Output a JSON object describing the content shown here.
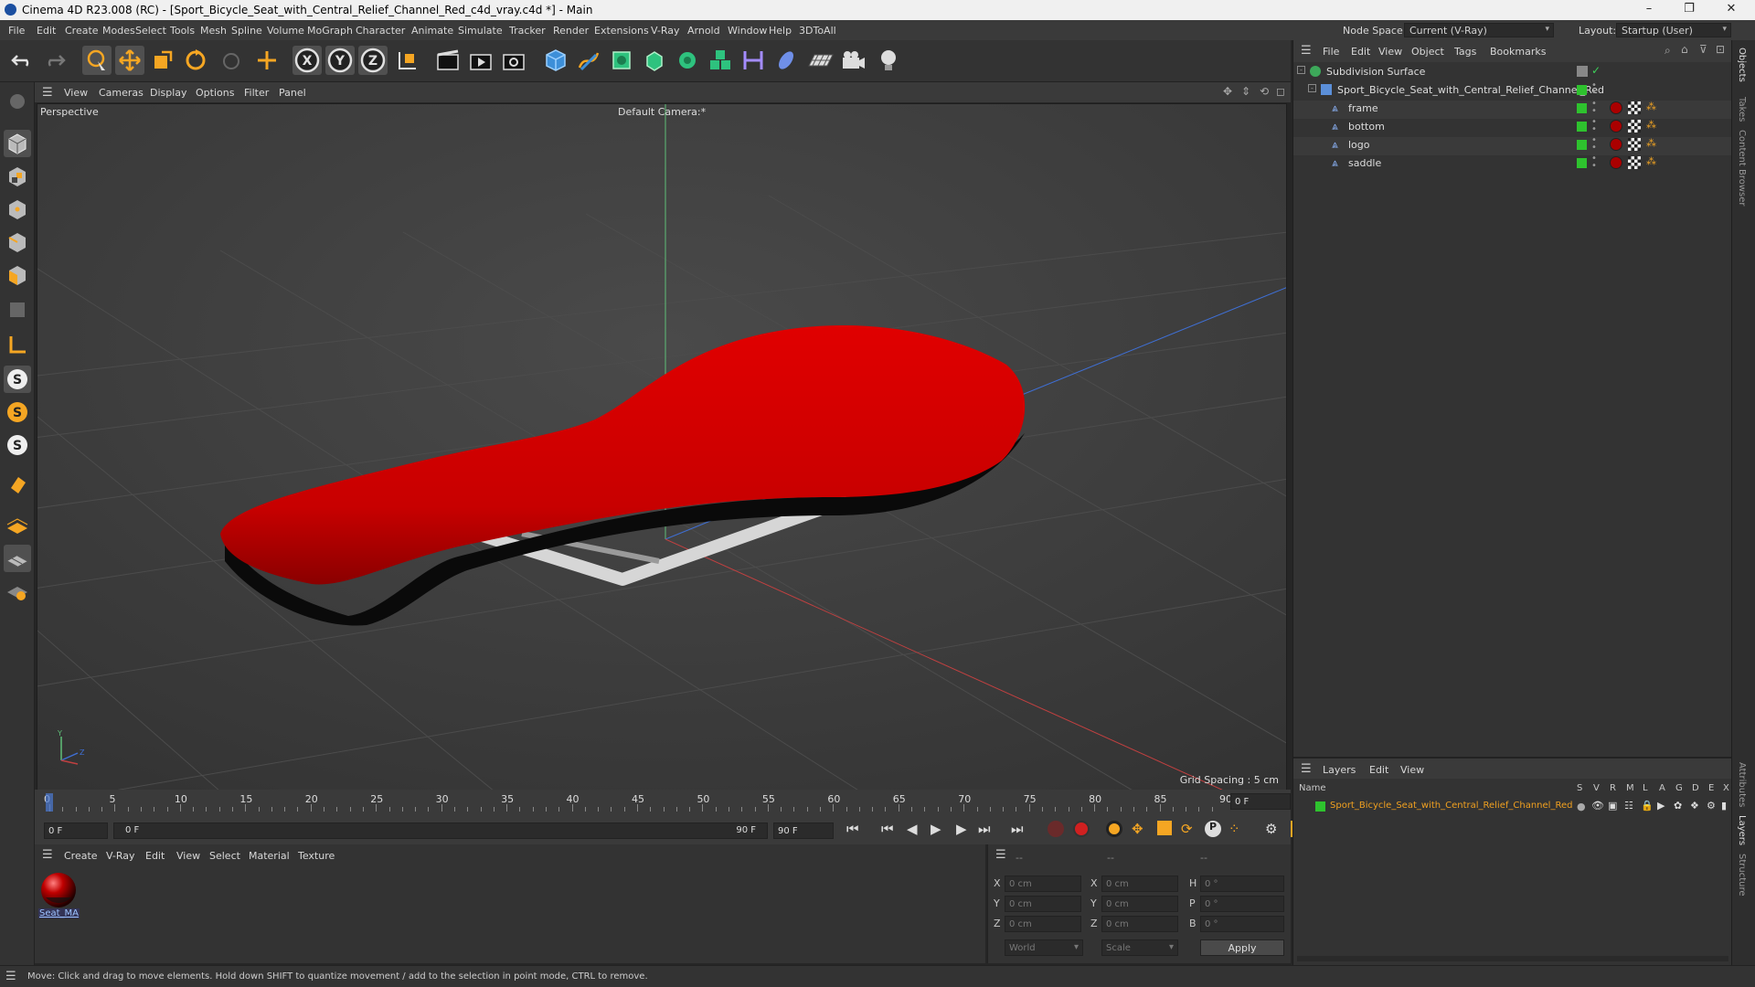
{
  "window": {
    "title": "Cinema 4D R23.008 (RC) - [Sport_Bicycle_Seat_with_Central_Relief_Channel_Red_c4d_vray.c4d *] - Main",
    "controls": [
      "–",
      "❐",
      "✕"
    ]
  },
  "menubar": {
    "items": [
      "File",
      "Edit",
      "Create",
      "Modes",
      "Select",
      "Tools",
      "Mesh",
      "Spline",
      "Volume",
      "MoGraph",
      "Character",
      "Animate",
      "Simulate",
      "Tracker",
      "Render",
      "Extensions",
      "V-Ray",
      "Arnold",
      "Window",
      "Help",
      "3DToAll"
    ],
    "node_space_label": "Node Space:",
    "node_space_value": "Current (V-Ray)",
    "layout_label": "Layout:",
    "layout_value": "Startup (User)"
  },
  "viewport": {
    "menu": [
      "View",
      "Cameras",
      "Display",
      "Options",
      "Filter",
      "Panel"
    ],
    "name": "Perspective",
    "camera": "Default Camera",
    "camera_suffix": ":*",
    "grid_spacing": "Grid Spacing : 5 cm",
    "colors": {
      "seat": "#d40000",
      "seat_bottom": "#0a0a0a",
      "frame": "#d6d6d6",
      "background": "#3e3e3e"
    }
  },
  "timeline": {
    "ticks": [
      "0",
      "5",
      "10",
      "15",
      "20",
      "25",
      "30",
      "35",
      "40",
      "45",
      "50",
      "55",
      "60",
      "65",
      "70",
      "75",
      "80",
      "85",
      "90"
    ],
    "current_frame": "0 F",
    "start_field": "0 F",
    "range_start": "0 F",
    "range_end": "90 F",
    "end_field": "90 F"
  },
  "material_panel": {
    "menu": [
      "Create",
      "V-Ray",
      "Edit",
      "View",
      "Select",
      "Material",
      "Texture"
    ],
    "materials": [
      {
        "name": "Seat_MA"
      }
    ]
  },
  "coords": {
    "headers": [
      "--",
      "--",
      "--"
    ],
    "rows": [
      {
        "a": "X",
        "av": "0 cm",
        "b": "X",
        "bv": "0 cm",
        "c": "H",
        "cv": "0 °"
      },
      {
        "a": "Y",
        "av": "0 cm",
        "b": "Y",
        "bv": "0 cm",
        "c": "P",
        "cv": "0 °"
      },
      {
        "a": "Z",
        "av": "0 cm",
        "b": "Z",
        "bv": "0 cm",
        "c": "B",
        "cv": "0 °"
      }
    ],
    "space_select": "World",
    "mode_select": "Scale",
    "apply_label": "Apply"
  },
  "object_manager": {
    "menu": [
      "File",
      "Edit",
      "View",
      "Object",
      "Tags",
      "Bookmarks"
    ],
    "objects": [
      {
        "name": "Subdivision Surface",
        "level": 0
      },
      {
        "name": "Sport_Bicycle_Seat_with_Central_Relief_Channel_Red",
        "level": 1
      },
      {
        "name": "frame",
        "level": 2
      },
      {
        "name": "bottom",
        "level": 2
      },
      {
        "name": "logo",
        "level": 2
      },
      {
        "name": "saddle",
        "level": 2
      }
    ]
  },
  "layer_manager": {
    "menu": [
      "Layers",
      "Edit",
      "View"
    ],
    "name_header": "Name",
    "flag_headers": [
      "S",
      "V",
      "R",
      "M",
      "L",
      "A",
      "G",
      "D",
      "E",
      "X"
    ],
    "layers": [
      {
        "name": "Sport_Bicycle_Seat_with_Central_Relief_Channel_Red",
        "color": "#f0a020"
      }
    ]
  },
  "right_tabs": [
    "Objects",
    "Takes",
    "Content Browser",
    "Attributes",
    "Layers",
    "Structure"
  ],
  "status": {
    "message": "Move: Click and drag to move elements. Hold down SHIFT to quantize movement / add to the selection in point mode, CTRL to remove."
  }
}
